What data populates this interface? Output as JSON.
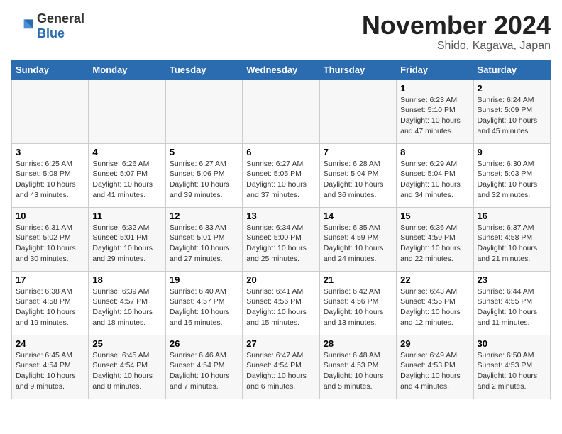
{
  "header": {
    "logo_text_general": "General",
    "logo_text_blue": "Blue",
    "month_title": "November 2024",
    "subtitle": "Shido, Kagawa, Japan"
  },
  "calendar": {
    "weekdays": [
      "Sunday",
      "Monday",
      "Tuesday",
      "Wednesday",
      "Thursday",
      "Friday",
      "Saturday"
    ],
    "weeks": [
      [
        {
          "day": "",
          "info": ""
        },
        {
          "day": "",
          "info": ""
        },
        {
          "day": "",
          "info": ""
        },
        {
          "day": "",
          "info": ""
        },
        {
          "day": "",
          "info": ""
        },
        {
          "day": "1",
          "info": "Sunrise: 6:23 AM\nSunset: 5:10 PM\nDaylight: 10 hours and 47 minutes."
        },
        {
          "day": "2",
          "info": "Sunrise: 6:24 AM\nSunset: 5:09 PM\nDaylight: 10 hours and 45 minutes."
        }
      ],
      [
        {
          "day": "3",
          "info": "Sunrise: 6:25 AM\nSunset: 5:08 PM\nDaylight: 10 hours and 43 minutes."
        },
        {
          "day": "4",
          "info": "Sunrise: 6:26 AM\nSunset: 5:07 PM\nDaylight: 10 hours and 41 minutes."
        },
        {
          "day": "5",
          "info": "Sunrise: 6:27 AM\nSunset: 5:06 PM\nDaylight: 10 hours and 39 minutes."
        },
        {
          "day": "6",
          "info": "Sunrise: 6:27 AM\nSunset: 5:05 PM\nDaylight: 10 hours and 37 minutes."
        },
        {
          "day": "7",
          "info": "Sunrise: 6:28 AM\nSunset: 5:04 PM\nDaylight: 10 hours and 36 minutes."
        },
        {
          "day": "8",
          "info": "Sunrise: 6:29 AM\nSunset: 5:04 PM\nDaylight: 10 hours and 34 minutes."
        },
        {
          "day": "9",
          "info": "Sunrise: 6:30 AM\nSunset: 5:03 PM\nDaylight: 10 hours and 32 minutes."
        }
      ],
      [
        {
          "day": "10",
          "info": "Sunrise: 6:31 AM\nSunset: 5:02 PM\nDaylight: 10 hours and 30 minutes."
        },
        {
          "day": "11",
          "info": "Sunrise: 6:32 AM\nSunset: 5:01 PM\nDaylight: 10 hours and 29 minutes."
        },
        {
          "day": "12",
          "info": "Sunrise: 6:33 AM\nSunset: 5:01 PM\nDaylight: 10 hours and 27 minutes."
        },
        {
          "day": "13",
          "info": "Sunrise: 6:34 AM\nSunset: 5:00 PM\nDaylight: 10 hours and 25 minutes."
        },
        {
          "day": "14",
          "info": "Sunrise: 6:35 AM\nSunset: 4:59 PM\nDaylight: 10 hours and 24 minutes."
        },
        {
          "day": "15",
          "info": "Sunrise: 6:36 AM\nSunset: 4:59 PM\nDaylight: 10 hours and 22 minutes."
        },
        {
          "day": "16",
          "info": "Sunrise: 6:37 AM\nSunset: 4:58 PM\nDaylight: 10 hours and 21 minutes."
        }
      ],
      [
        {
          "day": "17",
          "info": "Sunrise: 6:38 AM\nSunset: 4:58 PM\nDaylight: 10 hours and 19 minutes."
        },
        {
          "day": "18",
          "info": "Sunrise: 6:39 AM\nSunset: 4:57 PM\nDaylight: 10 hours and 18 minutes."
        },
        {
          "day": "19",
          "info": "Sunrise: 6:40 AM\nSunset: 4:57 PM\nDaylight: 10 hours and 16 minutes."
        },
        {
          "day": "20",
          "info": "Sunrise: 6:41 AM\nSunset: 4:56 PM\nDaylight: 10 hours and 15 minutes."
        },
        {
          "day": "21",
          "info": "Sunrise: 6:42 AM\nSunset: 4:56 PM\nDaylight: 10 hours and 13 minutes."
        },
        {
          "day": "22",
          "info": "Sunrise: 6:43 AM\nSunset: 4:55 PM\nDaylight: 10 hours and 12 minutes."
        },
        {
          "day": "23",
          "info": "Sunrise: 6:44 AM\nSunset: 4:55 PM\nDaylight: 10 hours and 11 minutes."
        }
      ],
      [
        {
          "day": "24",
          "info": "Sunrise: 6:45 AM\nSunset: 4:54 PM\nDaylight: 10 hours and 9 minutes."
        },
        {
          "day": "25",
          "info": "Sunrise: 6:45 AM\nSunset: 4:54 PM\nDaylight: 10 hours and 8 minutes."
        },
        {
          "day": "26",
          "info": "Sunrise: 6:46 AM\nSunset: 4:54 PM\nDaylight: 10 hours and 7 minutes."
        },
        {
          "day": "27",
          "info": "Sunrise: 6:47 AM\nSunset: 4:54 PM\nDaylight: 10 hours and 6 minutes."
        },
        {
          "day": "28",
          "info": "Sunrise: 6:48 AM\nSunset: 4:53 PM\nDaylight: 10 hours and 5 minutes."
        },
        {
          "day": "29",
          "info": "Sunrise: 6:49 AM\nSunset: 4:53 PM\nDaylight: 10 hours and 4 minutes."
        },
        {
          "day": "30",
          "info": "Sunrise: 6:50 AM\nSunset: 4:53 PM\nDaylight: 10 hours and 2 minutes."
        }
      ]
    ]
  }
}
